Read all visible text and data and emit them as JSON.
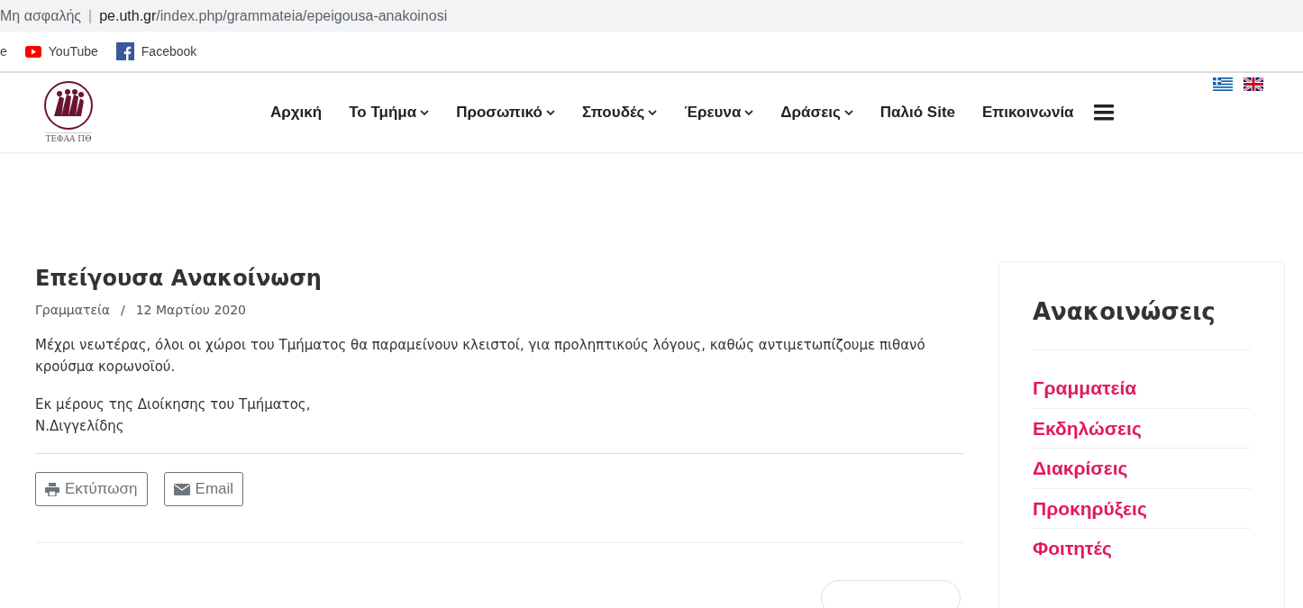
{
  "address_bar": {
    "security": "Μη ασφαλής",
    "domain": "pe.uth.gr",
    "path": "/index.php/grammateia/epeigousa-anakoinosi",
    "divider": "|"
  },
  "bookmarks": [
    {
      "label": "e",
      "kind": "plain"
    },
    {
      "label": "YouTube",
      "kind": "youtube"
    },
    {
      "label": "Facebook",
      "kind": "facebook"
    }
  ],
  "header": {
    "logo_text": "ΤΕΦΑΑ ΠΘ",
    "nav": [
      {
        "label": "Αρχική",
        "dropdown": false
      },
      {
        "label": "Το Τμήμα",
        "dropdown": true
      },
      {
        "label": "Προσωπικό",
        "dropdown": true
      },
      {
        "label": "Σπουδές",
        "dropdown": true
      },
      {
        "label": "Έρευνα",
        "dropdown": true
      },
      {
        "label": "Δράσεις",
        "dropdown": true
      },
      {
        "label": "Παλιό Site",
        "dropdown": false
      },
      {
        "label": "Επικοινωνία",
        "dropdown": false
      }
    ]
  },
  "article": {
    "title": "Επείγουσα Ανακοίνωση",
    "category": "Γραμματεία",
    "separator": "/",
    "date": "12 Μαρτίου 2020",
    "paragraphs": [
      "Μέχρι νεωτέρας, όλοι οι χώροι του Τμήματος θα παραμείνουν κλειστοί, για προληπτικούς λόγους, καθώς αντιμετωπίζουμε πιθανό κρούσμα κορωνοϊού.",
      "Εκ μέρους της Διοίκησης του Τμήματος,\nΝ.Διγγελίδης"
    ],
    "actions": [
      {
        "label": "Εκτύπωση",
        "kind": "print"
      },
      {
        "label": "Email",
        "kind": "email"
      }
    ]
  },
  "sidebar": {
    "title": "Ανακοινώσεις",
    "items": [
      "Γραμματεία",
      "Εκδηλώσεις",
      "Διακρίσεις",
      "Προκηρύξεις",
      "Φοιτητές"
    ]
  }
}
